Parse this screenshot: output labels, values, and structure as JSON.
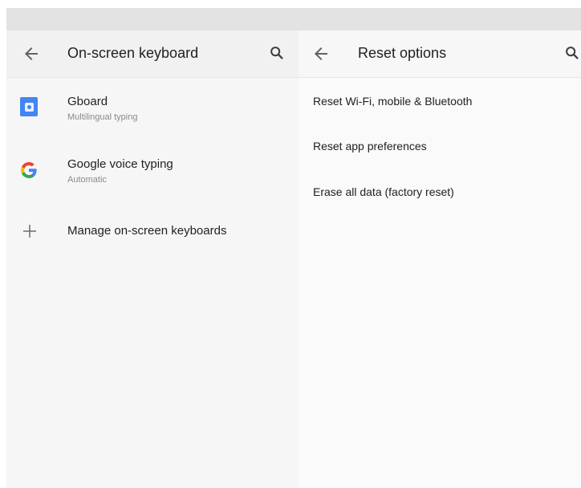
{
  "left_panel": {
    "title": "On-screen keyboard",
    "back_icon": "arrow-back-icon",
    "search_icon": "search-icon",
    "items": [
      {
        "title": "Gboard",
        "subtitle": "Multilingual typing",
        "icon": "gboard-icon"
      },
      {
        "title": "Google voice typing",
        "subtitle": "Automatic",
        "icon": "google-g-icon"
      },
      {
        "title": "Manage on-screen keyboards",
        "icon": "plus-icon"
      }
    ]
  },
  "right_panel": {
    "title": "Reset options",
    "back_icon": "arrow-back-icon",
    "search_icon": "search-icon",
    "items": [
      {
        "title": "Reset Wi-Fi, mobile & Bluetooth"
      },
      {
        "title": "Reset app preferences"
      },
      {
        "title": "Erase all data (factory reset)"
      }
    ]
  },
  "colors": {
    "google_blue": "#4285f4",
    "text_primary": "#202124",
    "text_secondary": "#8a8a8a"
  }
}
